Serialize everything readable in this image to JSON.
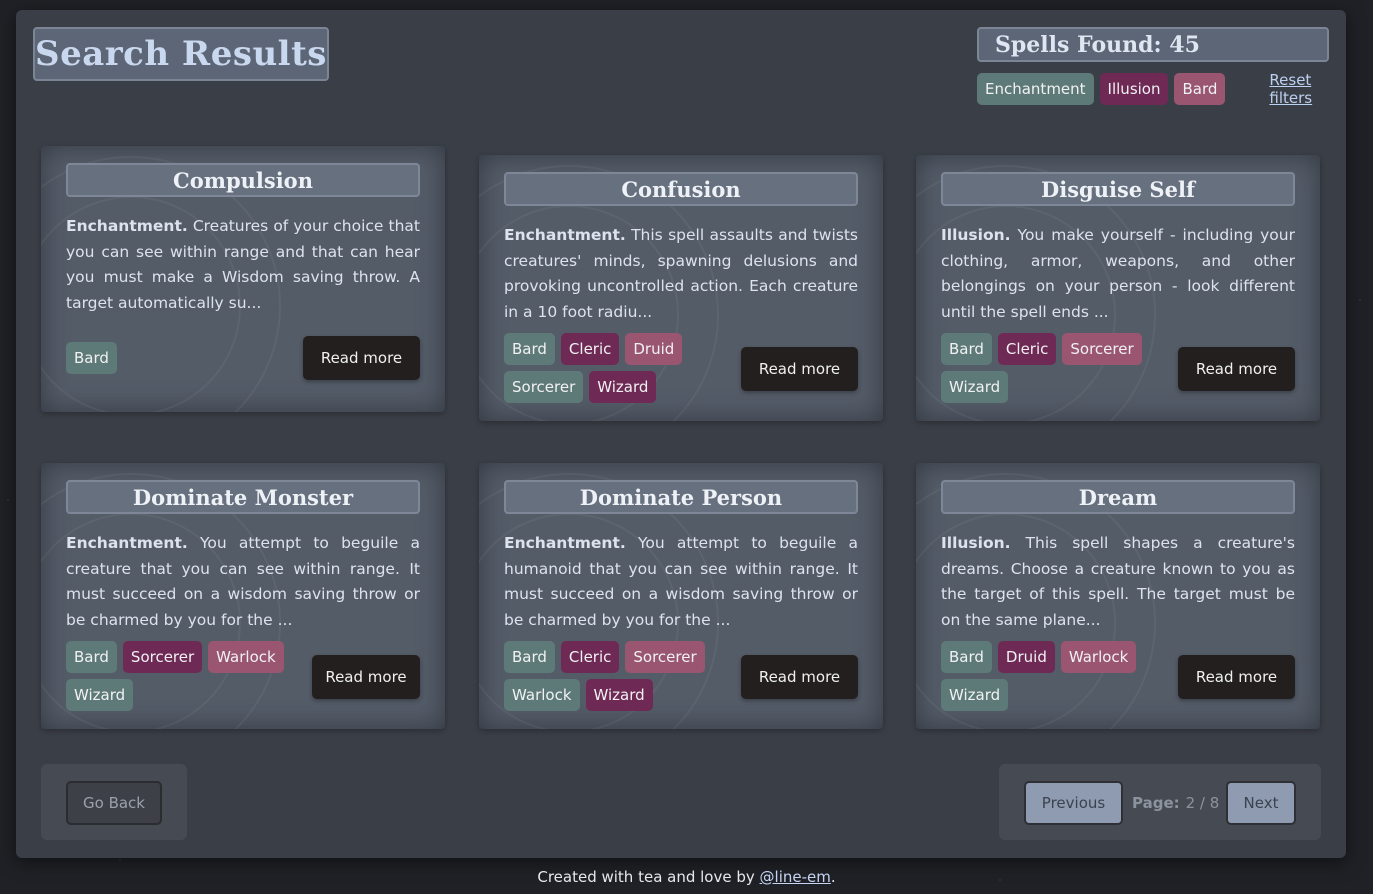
{
  "header": {
    "title": "Search Results",
    "spells_found_label": "Spells Found: 45",
    "filters": [
      {
        "label": "Enchantment",
        "color": "#5e7a78"
      },
      {
        "label": "Illusion",
        "color": "#6e2a55"
      },
      {
        "label": "Bard",
        "color": "#9a5670"
      }
    ],
    "reset_label": "Reset filters"
  },
  "cards": [
    {
      "title": "Compulsion",
      "school": "Enchantment.",
      "description": " Creatures of your choice that you can see within range and that can hear you must make a Wisdom saving throw. A target automatically su...",
      "classes": [
        "Bard"
      ],
      "read_more": "Read more"
    },
    {
      "title": "Confusion",
      "school": "Enchantment.",
      "description": " This spell assaults and twists creatures' minds, spawning delusions and provoking uncontrolled action. Each creature in a 10 foot radiu...",
      "classes": [
        "Bard",
        "Cleric",
        "Druid",
        "Sorcerer",
        "Wizard"
      ],
      "read_more": "Read more"
    },
    {
      "title": "Disguise Self",
      "school": "Illusion.",
      "description": " You make yourself - including your clothing, armor, weapons, and other belongings on your person - look different until the spell ends ...",
      "classes": [
        "Bard",
        "Cleric",
        "Sorcerer",
        "Wizard"
      ],
      "read_more": "Read more"
    },
    {
      "title": "Dominate Monster",
      "school": "Enchantment.",
      "description": " You attempt to beguile a creature that you can see within range. It must succeed on a wisdom saving throw or be charmed by you for the ...",
      "classes": [
        "Bard",
        "Sorcerer",
        "Warlock",
        "Wizard"
      ],
      "read_more": "Read more"
    },
    {
      "title": "Dominate Person",
      "school": "Enchantment.",
      "description": " You attempt to beguile a humanoid that you can see within range. It must succeed on a wisdom saving throw or be charmed by you for the ...",
      "classes": [
        "Bard",
        "Cleric",
        "Sorcerer",
        "Warlock",
        "Wizard"
      ],
      "read_more": "Read more"
    },
    {
      "title": "Dream",
      "school": "Illusion.",
      "description": " This spell shapes a creature's dreams. Choose a creature known to you as the target of this spell. The target must be on the same plane...",
      "classes": [
        "Bard",
        "Druid",
        "Warlock",
        "Wizard"
      ],
      "read_more": "Read more"
    }
  ],
  "navigation": {
    "go_back": "Go Back",
    "previous": "Previous",
    "page_label": "Page:",
    "page_value": "2 / 8",
    "next": "Next"
  },
  "footer": {
    "prefix": "Created with tea and love by ",
    "link": "@line-em",
    "suffix": "."
  }
}
